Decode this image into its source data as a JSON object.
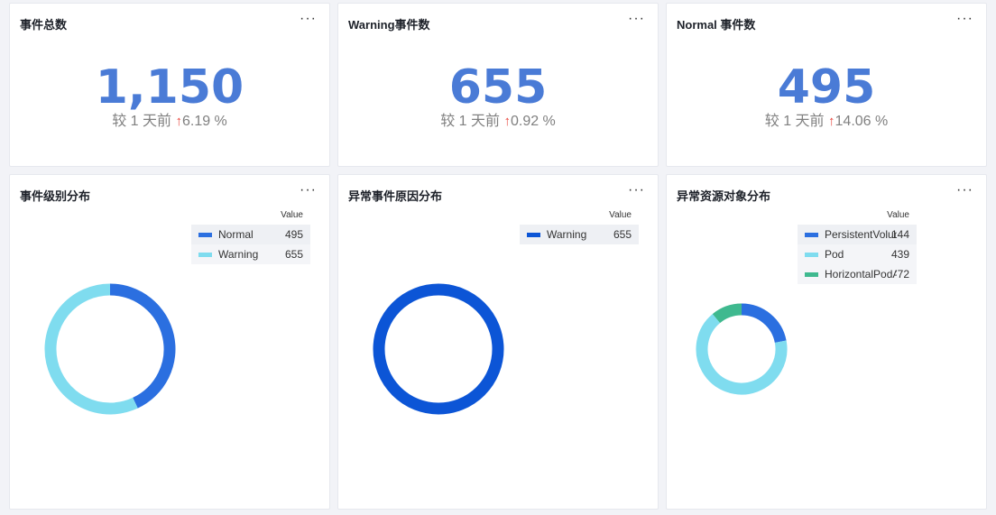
{
  "cards": {
    "total": {
      "title": "事件总数",
      "value": "1,150",
      "cmp_prefix": "较 1 天前",
      "arrow": "↑",
      "cmp_value": "6.19 %"
    },
    "warning": {
      "title": "Warning事件数",
      "value": "655",
      "cmp_prefix": "较 1 天前",
      "arrow": "↑",
      "cmp_value": "0.92 %"
    },
    "normal": {
      "title": "Normal 事件数",
      "value": "495",
      "cmp_prefix": "较 1 天前",
      "arrow": "↑",
      "cmp_value": "14.06 %"
    }
  },
  "more_label": "···",
  "chart_data": [
    {
      "type": "pie",
      "title": "事件级别分布",
      "legend_header": "Value",
      "legend_placement": "top-right",
      "series": [
        {
          "name": "Normal",
          "value": 495,
          "display": "495",
          "color": "#2b6fe0"
        },
        {
          "name": "Warning",
          "value": 655,
          "display": "655",
          "color": "#7fdcef"
        }
      ]
    },
    {
      "type": "pie",
      "title": "异常事件原因分布",
      "legend_header": "Value",
      "legend_placement": "top-right",
      "series": [
        {
          "name": "Warning",
          "value": 655,
          "display": "655",
          "color": "#0c55d6"
        }
      ]
    },
    {
      "type": "pie",
      "title": "异常资源对象分布",
      "legend_header": "Value",
      "legend_placement": "top-right",
      "series": [
        {
          "name": "PersistentVolumeClaim",
          "value": 144,
          "display": "144",
          "color": "#2b6fe0"
        },
        {
          "name": "Pod",
          "value": 439,
          "display": "439",
          "color": "#7fdcef"
        },
        {
          "name": "HorizontalPodAutoscaler",
          "value": 72,
          "display": "72",
          "color": "#3fb98f"
        }
      ]
    }
  ]
}
